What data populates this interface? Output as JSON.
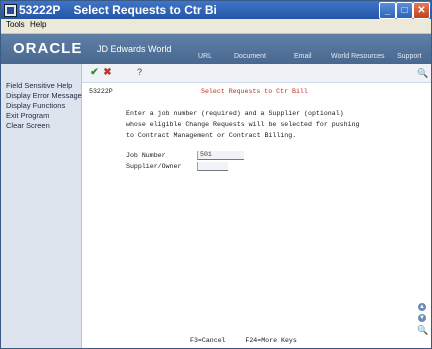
{
  "window": {
    "title": "53222P    Select Requests to Ctr Bi",
    "minimize_glyph": "_",
    "maximize_glyph": "□",
    "close_glyph": "✕"
  },
  "menubar": {
    "tools": "Tools",
    "help": "Help"
  },
  "banner": {
    "logo_oracle": "ORACLE",
    "logo_jde": "JD Edwards World",
    "links": [
      "URL",
      "Document",
      "Email",
      "World Resources",
      "Support"
    ]
  },
  "sidebar": {
    "items": [
      "Field Sensitive Help",
      "Display Error Message",
      "Display Functions",
      "Exit Program",
      "Clear Screen"
    ]
  },
  "toolbar": {
    "ok_glyph": "✔",
    "cancel_glyph": "✖",
    "help_glyph": "?",
    "zoom_glyph": "🔍"
  },
  "screen": {
    "program_id": "53222P",
    "title": "Select Requests to Ctr Bill",
    "instructions": [
      "Enter a job number (required) and a Supplier (optional)",
      "whose eligible Change Requests will be selected for pushing",
      "to Contract Management or Contract Billing."
    ],
    "fields": {
      "job_number_label": "Job Number",
      "job_number_value": "501",
      "supplier_label": "Supplier/Owner",
      "supplier_value": ""
    },
    "function_keys": "F3=Cancel     F24=More Keys"
  },
  "scroll": {
    "up_glyph": "▲",
    "down_glyph": "▼",
    "zoom_glyph": "🔍"
  }
}
